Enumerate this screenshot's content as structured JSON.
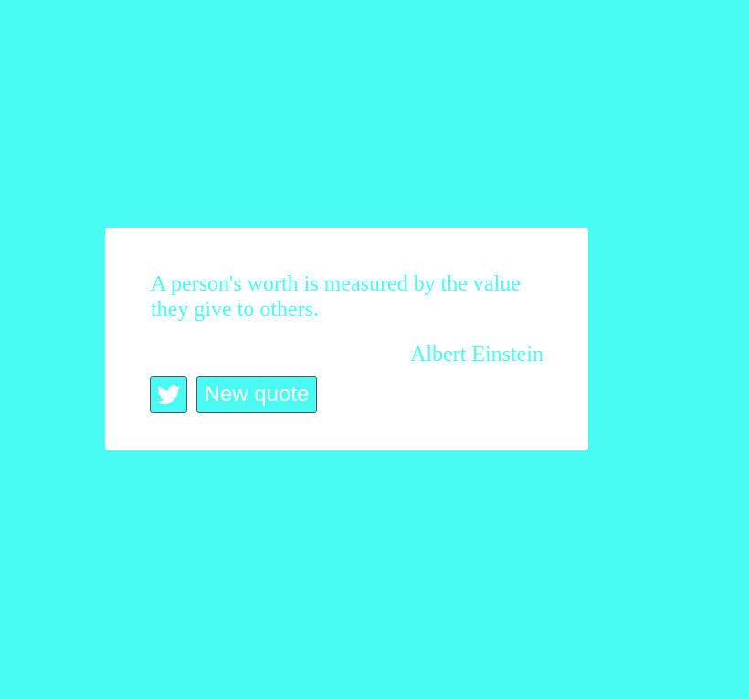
{
  "theme": {
    "accent_color": "#48FBF3",
    "card_color": "#FFFFFF",
    "button_text_color": "#FFFFFF"
  },
  "quote": {
    "text": "A person's worth is measured by the value they give to others.",
    "author": "Albert Einstein"
  },
  "actions": {
    "tweet_icon": "twitter-icon",
    "new_quote_label": "New quote"
  }
}
